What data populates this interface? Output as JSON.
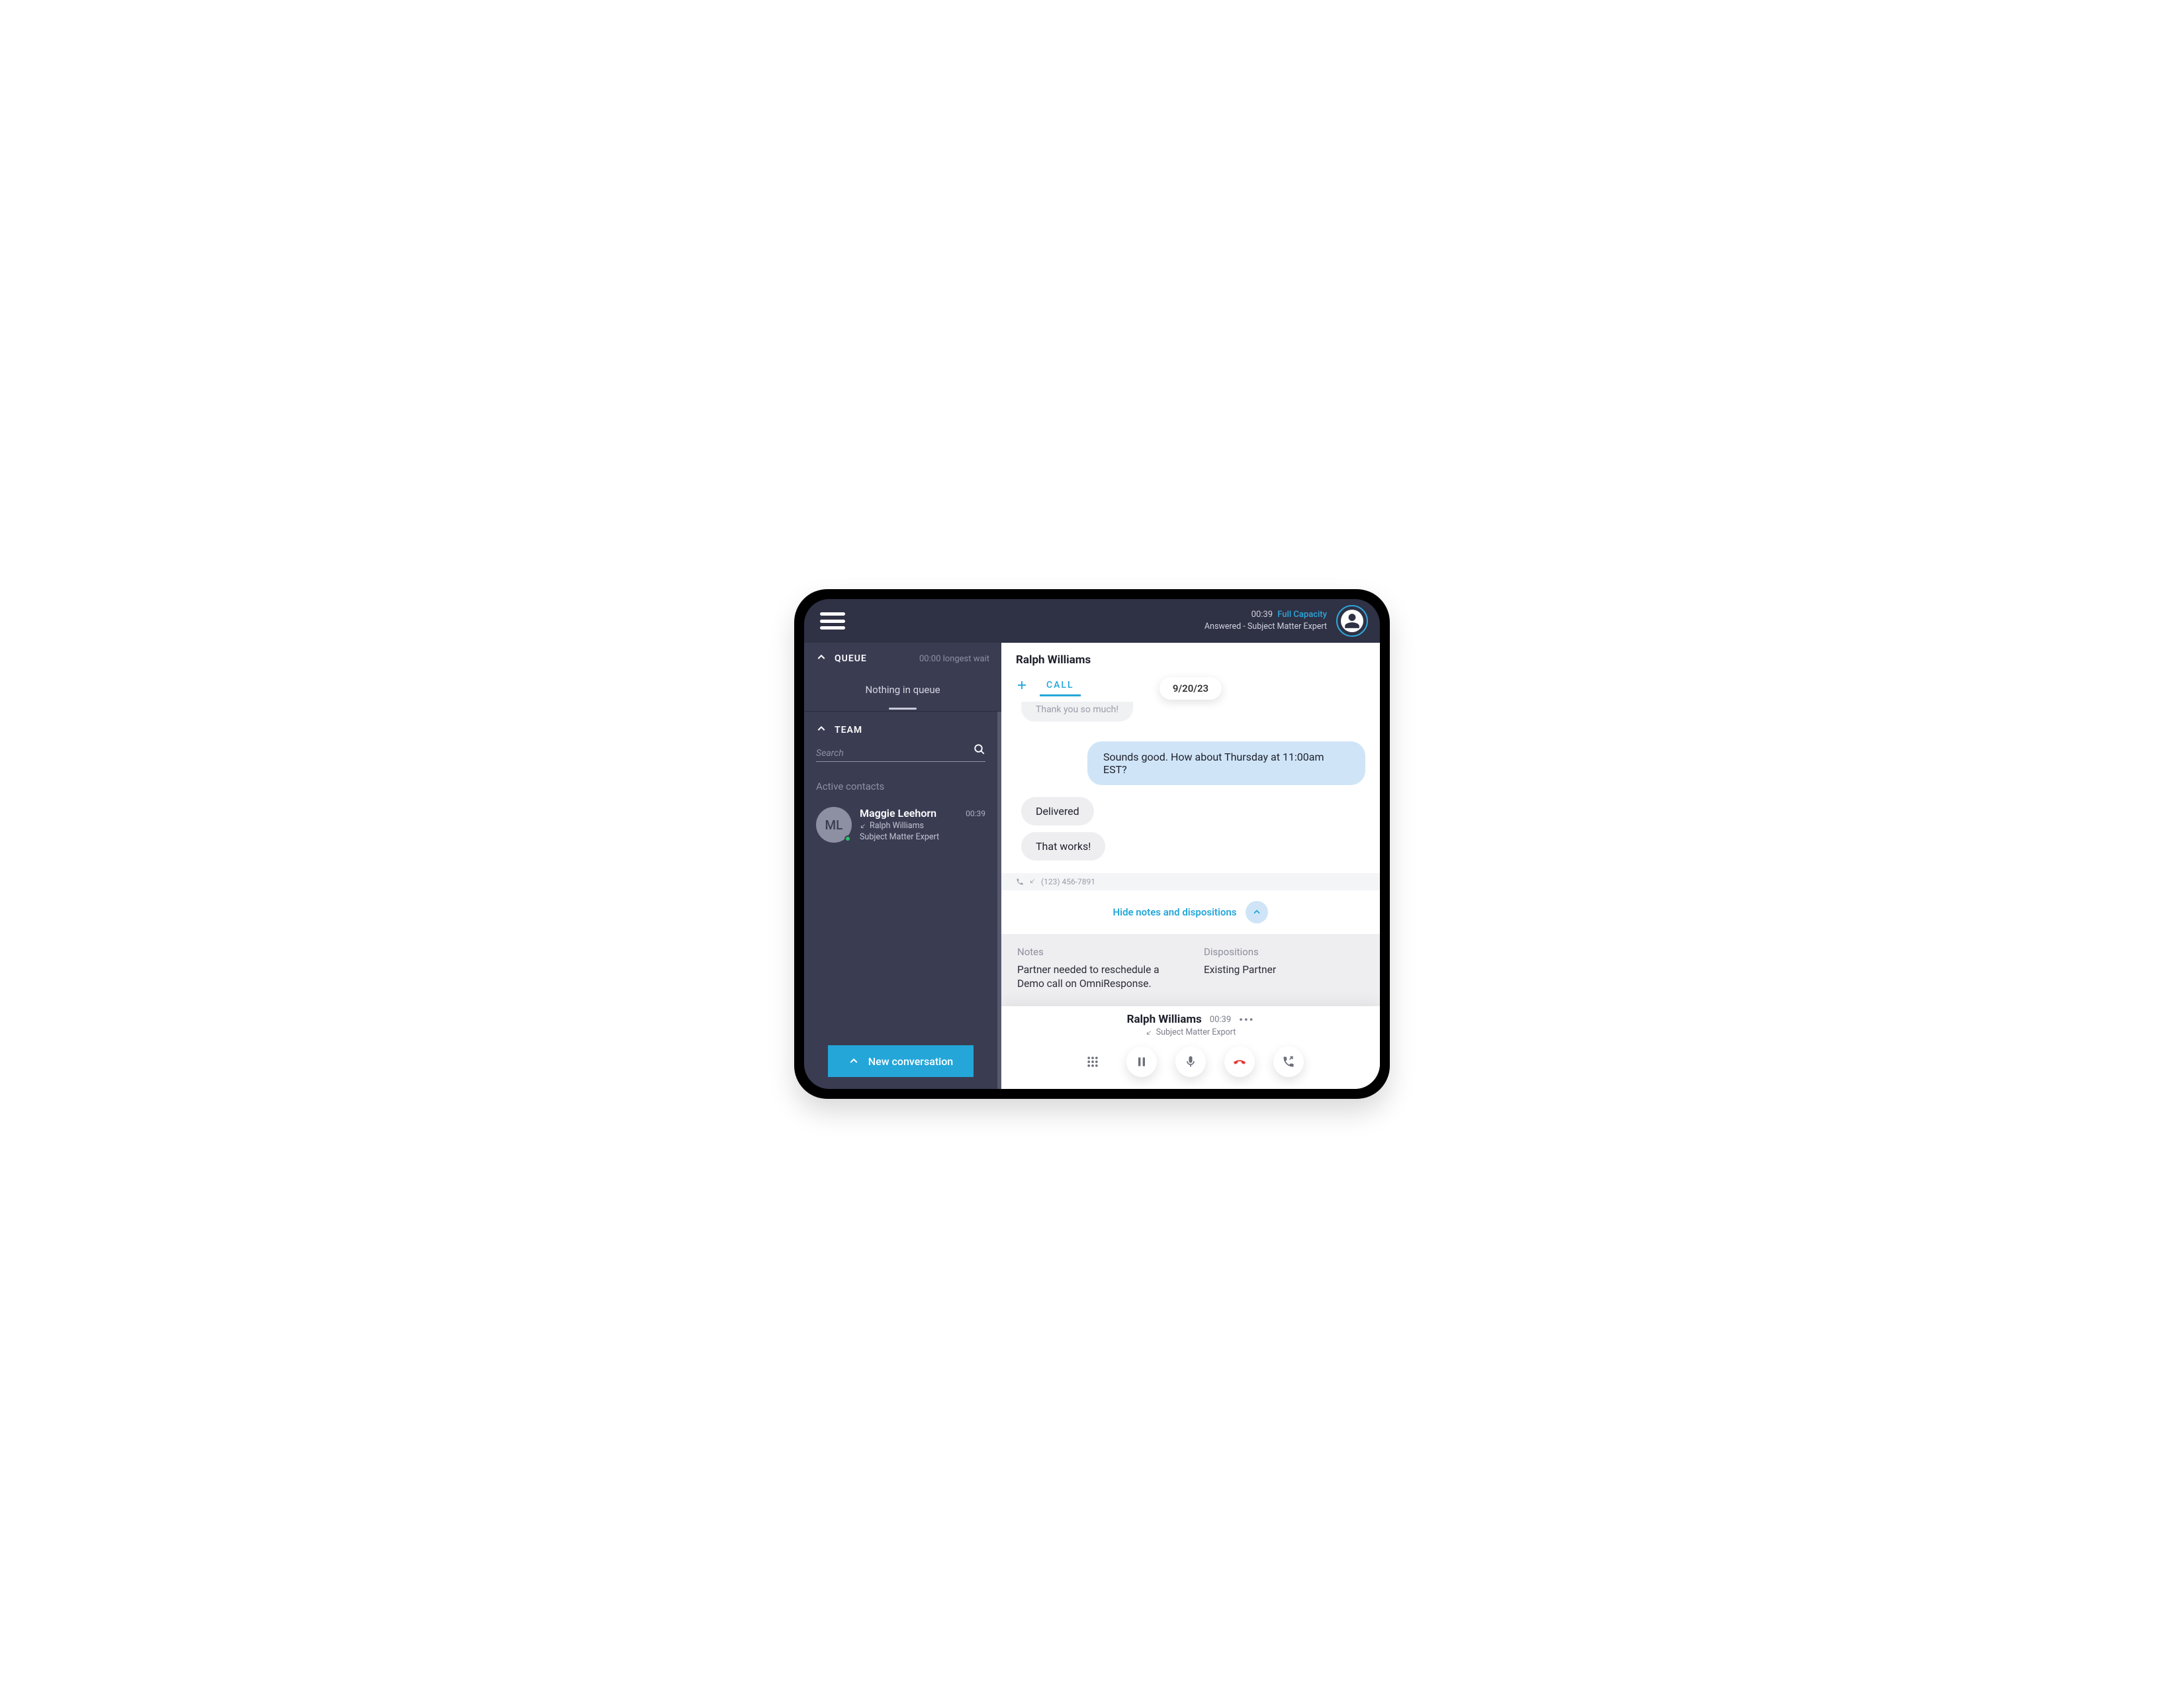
{
  "header": {
    "time": "00:39",
    "capacity": "Full Capacity",
    "status_line": "Answered - Subject Matter Expert"
  },
  "sidebar": {
    "queue": {
      "title": "QUEUE",
      "wait_label": "00:00 longest wait",
      "empty_text": "Nothing in queue"
    },
    "team": {
      "title": "TEAM",
      "search_placeholder": "Search",
      "active_label": "Active contacts",
      "contact": {
        "initials": "ML",
        "name": "Maggie Leehorn",
        "time": "00:39",
        "with_name": "Ralph Williams",
        "role": "Subject Matter Expert"
      }
    },
    "new_conversation_label": "New conversation"
  },
  "main": {
    "contact_name": "Ralph Williams",
    "tab_label": "CALL",
    "date_pill": "9/20/23",
    "messages": {
      "cut_off": "Thank you so much!",
      "agent_reply": "Sounds good. How about Thursday at 11:00am EST?",
      "delivered": "Delivered",
      "customer_reply": "That works!"
    },
    "phone_number": "(123) 456-7891",
    "toggle_label": "Hide notes and dispositions",
    "notes": {
      "heading": "Notes",
      "text": "Partner needed to reschedule a Demo call on OmniResponse."
    },
    "dispositions": {
      "heading": "Dispositions",
      "text": "Existing Partner"
    },
    "call_bar": {
      "name": "Ralph Williams",
      "time": "00:39",
      "role": "Subject Matter Export"
    }
  }
}
